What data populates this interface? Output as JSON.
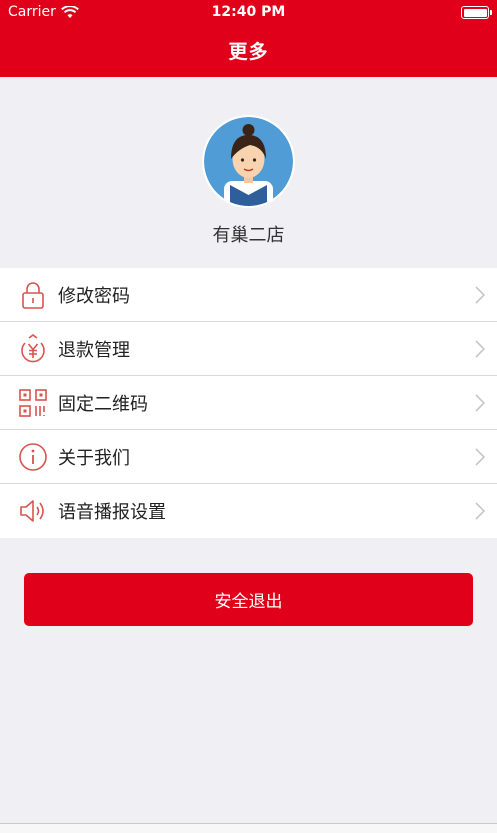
{
  "status_bar": {
    "carrier": "Carrier",
    "time": "12:40 PM"
  },
  "header": {
    "title": "更多"
  },
  "profile": {
    "store_name": "有巢二店"
  },
  "menu": [
    {
      "label": "修改密码",
      "icon": "lock-icon"
    },
    {
      "label": "退款管理",
      "icon": "refund-icon"
    },
    {
      "label": "固定二维码",
      "icon": "qrcode-icon"
    },
    {
      "label": "关于我们",
      "icon": "info-icon"
    },
    {
      "label": "语音播报设置",
      "icon": "speaker-icon"
    }
  ],
  "logout": {
    "label": "安全退出"
  },
  "colors": {
    "accent": "#e1001a",
    "background": "#efeff4",
    "avatar_bg": "#4f9cd6"
  }
}
